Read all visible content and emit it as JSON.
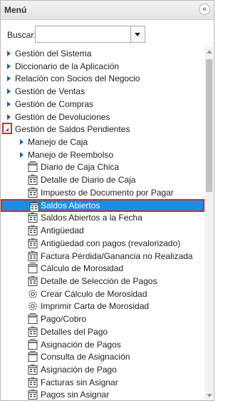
{
  "panel": {
    "title": "Menú",
    "collapse_glyph": "«"
  },
  "search": {
    "label": "Buscar:",
    "value": "",
    "placeholder": ""
  },
  "tree": [
    {
      "label": "Gestión del Sistema",
      "level": 0,
      "type": "folder",
      "expanded": false
    },
    {
      "label": "Diccionario de la Aplicación",
      "level": 0,
      "type": "folder",
      "expanded": false
    },
    {
      "label": "Relación con Socios del Negocio",
      "level": 0,
      "type": "folder",
      "expanded": false
    },
    {
      "label": "Gestión de Ventas",
      "level": 0,
      "type": "folder",
      "expanded": false
    },
    {
      "label": "Gestión de Compras",
      "level": 0,
      "type": "folder",
      "expanded": false
    },
    {
      "label": "Gestión de Devoluciones",
      "level": 0,
      "type": "folder",
      "expanded": false
    },
    {
      "label": "Gestión de Saldos Pendientes",
      "level": 0,
      "type": "folder",
      "expanded": true
    },
    {
      "label": "Manejo de Caja",
      "level": 1,
      "type": "folder",
      "expanded": false
    },
    {
      "label": "Manejo de Reembolso",
      "level": 1,
      "type": "folder",
      "expanded": false
    },
    {
      "label": "Diario de Caja Chica",
      "level": 2,
      "type": "window"
    },
    {
      "label": "Detalle de Diario de Caja",
      "level": 2,
      "type": "report"
    },
    {
      "label": "Impuesto de Documento por Pagar",
      "level": 2,
      "type": "report"
    },
    {
      "label": "Saldos Abiertos",
      "level": 2,
      "type": "report",
      "selected": true
    },
    {
      "label": "Saldos Abiertos a la Fecha",
      "level": 2,
      "type": "report"
    },
    {
      "label": "Antigüedad",
      "level": 2,
      "type": "report"
    },
    {
      "label": "Antigüedad con pagos (revalorizado)",
      "level": 2,
      "type": "report"
    },
    {
      "label": "Factura Pérdida/Ganancia no Realizada",
      "level": 2,
      "type": "report"
    },
    {
      "label": "Cálculo de Morosidad",
      "level": 2,
      "type": "window"
    },
    {
      "label": "Detalle de Selección de Pagos",
      "level": 2,
      "type": "report"
    },
    {
      "label": "Crear Cálculo de Morosidad",
      "level": 2,
      "type": "process"
    },
    {
      "label": "Imprimir Carta de Morosidad",
      "level": 2,
      "type": "process"
    },
    {
      "label": "Pago/Cobro",
      "level": 2,
      "type": "window"
    },
    {
      "label": "Detalles del Pago",
      "level": 2,
      "type": "report"
    },
    {
      "label": "Asignación de Pagos",
      "level": 2,
      "type": "window"
    },
    {
      "label": "Consulta de Asignación",
      "level": 2,
      "type": "window"
    },
    {
      "label": "Asignación de Pago",
      "level": 2,
      "type": "report"
    },
    {
      "label": "Facturas sin Asignar",
      "level": 2,
      "type": "report"
    },
    {
      "label": "Pagos sin Asignar",
      "level": 2,
      "type": "report"
    }
  ]
}
